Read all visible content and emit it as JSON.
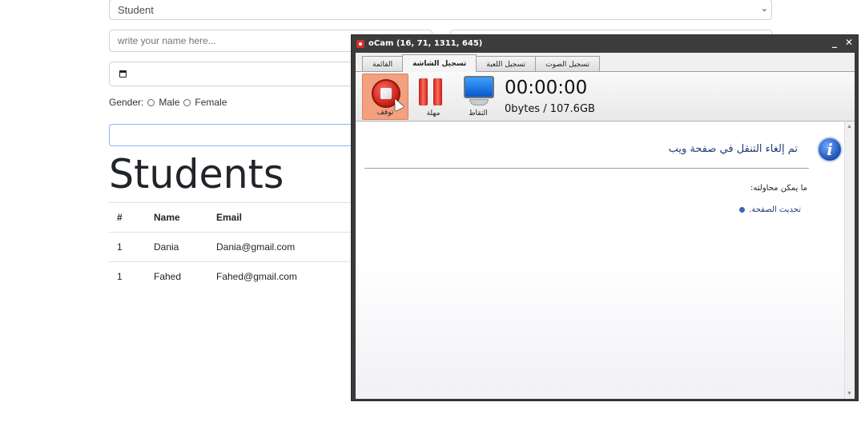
{
  "form": {
    "role_select_value": "Student",
    "name_placeholder": "write your name here...",
    "gender_label": "Gender:",
    "gender_options": [
      "Male",
      "Female"
    ]
  },
  "students": {
    "heading": "Students",
    "columns": [
      "#",
      "Name",
      "Email"
    ],
    "rows": [
      [
        "1",
        "Dania",
        "Dania@gmail.com"
      ],
      [
        "1",
        "Fahed",
        "Fahed@gmail.com"
      ]
    ]
  },
  "ocam": {
    "title": "oCam (16, 71, 1311, 645)",
    "window_buttons": [
      "_",
      "✕"
    ],
    "tabs": [
      "القائمة",
      "تسجيل الشاشة",
      "تسجيل اللعبة",
      "تسجيل الصوت"
    ],
    "active_tab": "تسجيل الشاشة",
    "buttons": {
      "stop": "توقف",
      "pause": "مهلة",
      "capture": "التقاط"
    },
    "timer": "00:00:00",
    "storage": "0bytes / 107.6GB",
    "message": {
      "title": "تم إلغاء التنقل في صفحة ويب",
      "try_label": "ما يمكن محاولته:",
      "try_item": "تحديث الصفحة."
    },
    "icons": {
      "app": "ocam-app-icon",
      "info": "info-icon"
    }
  }
}
